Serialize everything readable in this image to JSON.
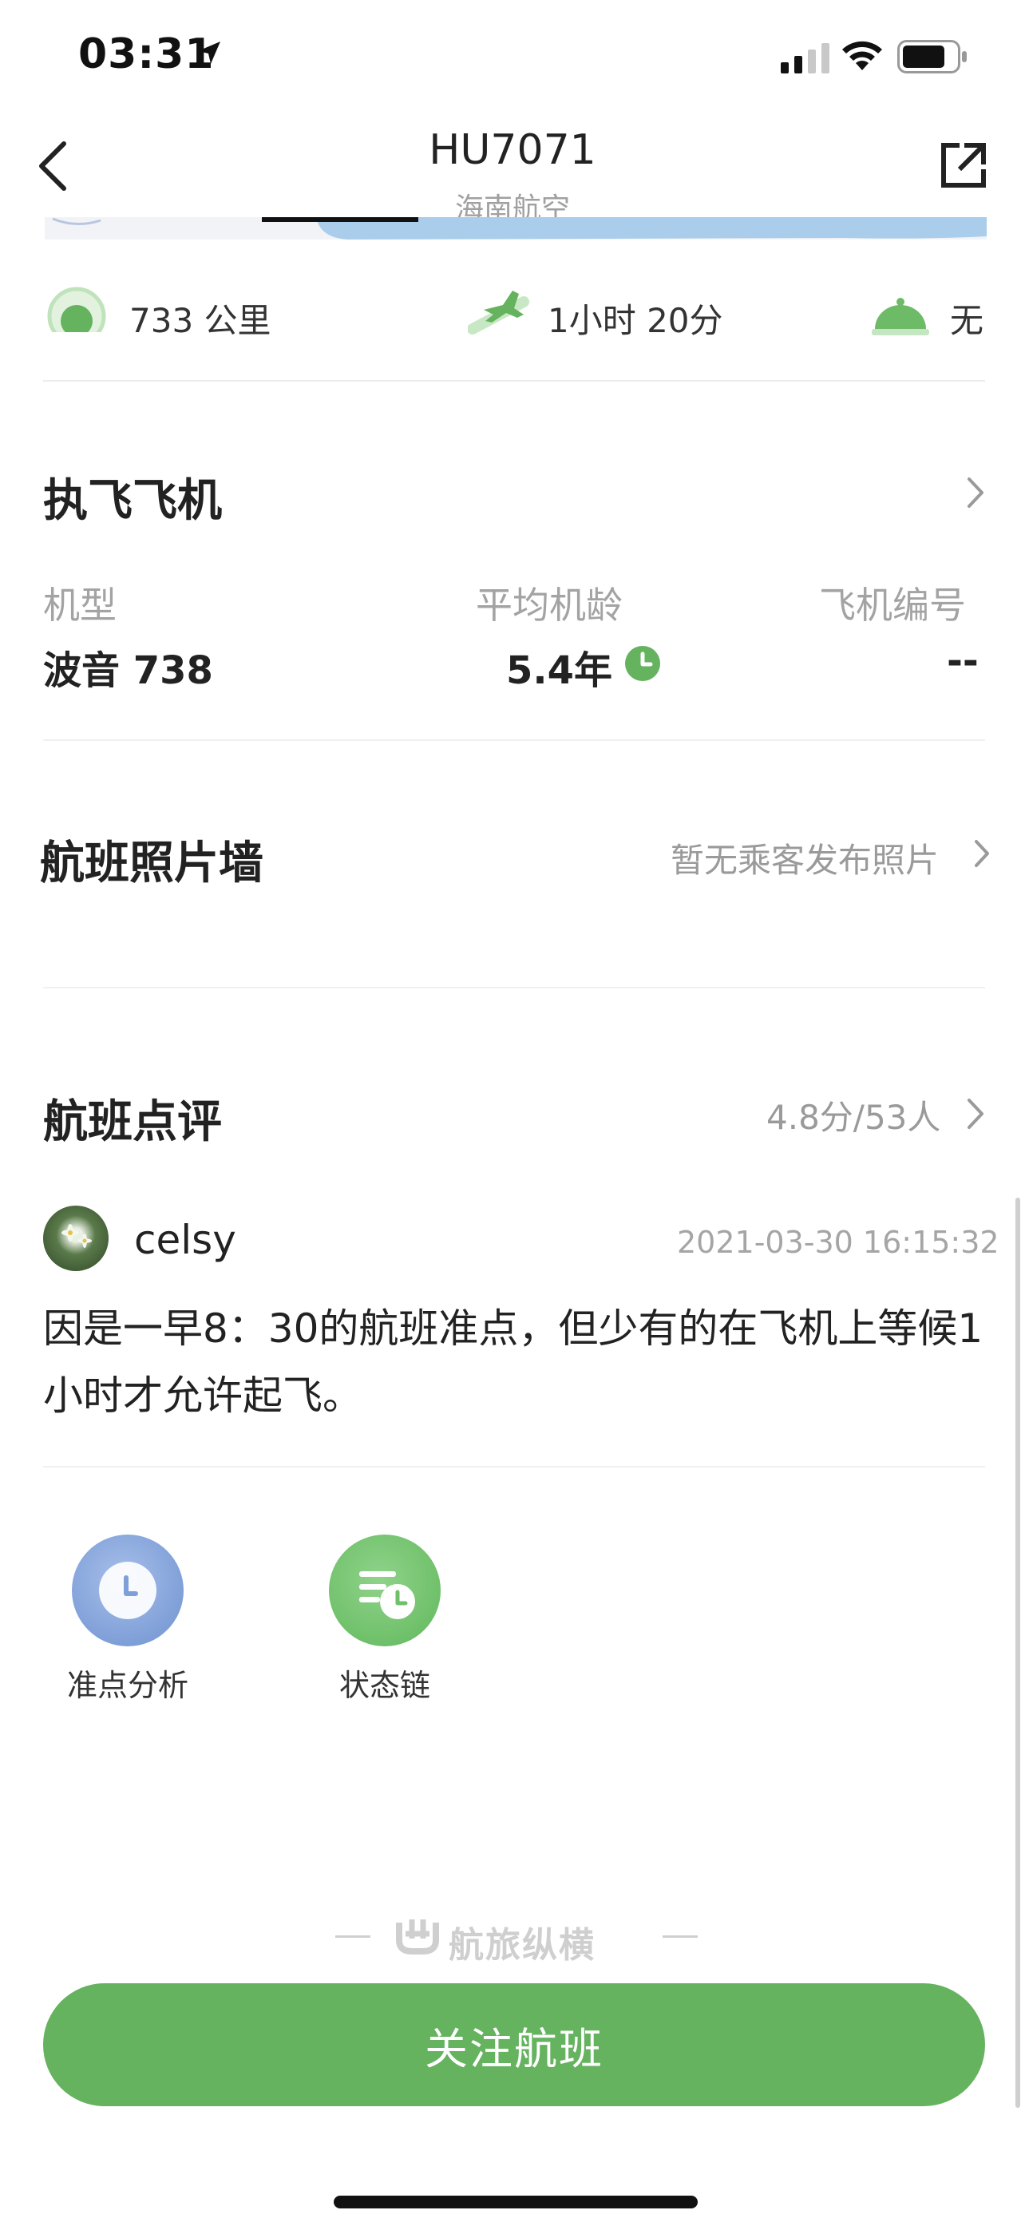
{
  "status_bar": {
    "time": "03:31"
  },
  "header": {
    "title": "HU7071",
    "subtitle": "海南航空"
  },
  "stats": {
    "distance": "733 公里",
    "duration": "1小时 20分",
    "meal": "无"
  },
  "aircraft": {
    "title": "执飞飞机",
    "model_label": "机型",
    "model_value": "波音 738",
    "age_label": "平均机龄",
    "age_value": "5.4年",
    "number_label": "飞机编号",
    "number_value": "--"
  },
  "photo_wall": {
    "title": "航班照片墙",
    "note": "暂无乘客发布照片"
  },
  "reviews": {
    "title": "航班点评",
    "summary": "4.8分/53人",
    "items": [
      {
        "user": "celsy",
        "time": "2021-03-30 16:15:32",
        "text": "因是一早8：30的航班准点，但少有的在飞机上等候1小时才允许起飞。"
      }
    ]
  },
  "quick_actions": [
    {
      "label": "准点分析",
      "icon": "clock-icon",
      "color": "#7fa0d6"
    },
    {
      "label": "状态链",
      "icon": "status-chain-icon",
      "color": "#6fc06a"
    }
  ],
  "footer": {
    "brand": "航旅纵横",
    "follow_button": "关注航班"
  },
  "colors": {
    "accent": "#65b25f",
    "muted_text": "#9a9a9a"
  }
}
